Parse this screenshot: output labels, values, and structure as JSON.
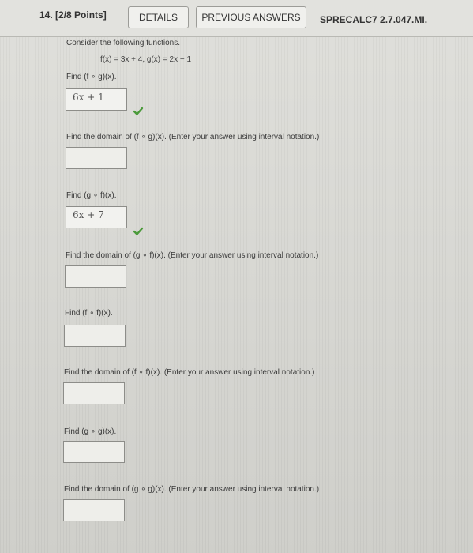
{
  "header": {
    "question_number": "14.",
    "points": "[2/8 Points]",
    "details_label": "DETAILS",
    "previous_answers_label": "PREVIOUS ANSWERS",
    "source_code": "SPRECALC7 2.7.047.MI."
  },
  "problem": {
    "intro": "Consider the following functions.",
    "functions": "f(x) = 3x + 4,   g(x) = 2x − 1",
    "parts": [
      {
        "prompt": "Find  (f ∘ g)(x).",
        "answer": "6x + 1",
        "correct": true
      },
      {
        "prompt": "Find the domain of  (f ∘ g)(x).  (Enter your answer using interval notation.)",
        "answer": ""
      },
      {
        "prompt": "Find  (g ∘ f)(x).",
        "answer": "6x + 7",
        "correct": true
      },
      {
        "prompt": "Find the domain of  (g ∘ f)(x).  (Enter your answer using interval notation.)",
        "answer": ""
      },
      {
        "prompt": "Find  (f ∘ f)(x).",
        "answer": ""
      },
      {
        "prompt": "Find the domain of  (f ∘ f)(x).  (Enter your answer using interval notation.)",
        "answer": ""
      },
      {
        "prompt": "Find  (g ∘ g)(x).",
        "answer": ""
      },
      {
        "prompt": "Find the domain of  (g ∘ g)(x).  (Enter your answer using interval notation.)",
        "answer": ""
      }
    ]
  },
  "colors": {
    "correct_check": "#4a9a3a"
  }
}
